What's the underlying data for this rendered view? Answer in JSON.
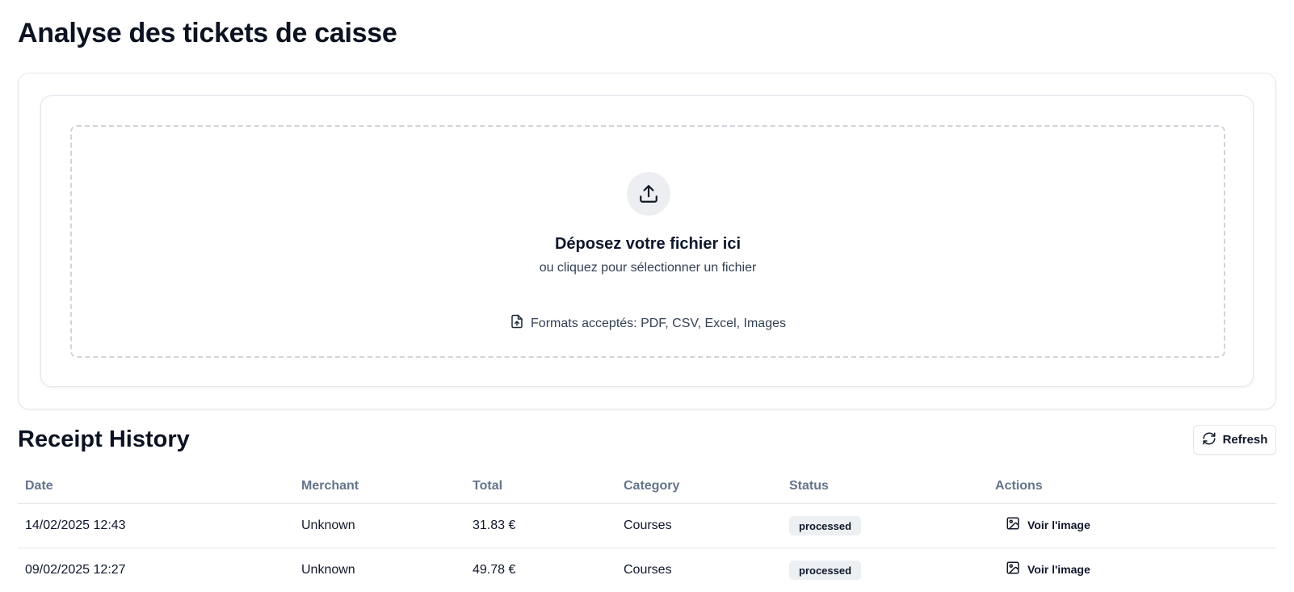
{
  "page": {
    "title": "Analyse des tickets de caisse"
  },
  "upload": {
    "title": "Déposez votre fichier ici",
    "subtitle": "ou cliquez pour sélectionner un fichier",
    "formats": "Formats acceptés: PDF, CSV, Excel, Images",
    "icon": "upload-icon",
    "formats_icon": "file-upload-icon"
  },
  "history": {
    "title": "Receipt History",
    "refresh_label": "Refresh",
    "refresh_icon": "refresh-icon",
    "columns": [
      "Date",
      "Merchant",
      "Total",
      "Category",
      "Status",
      "Actions"
    ],
    "rows": [
      {
        "date": "14/02/2025 12:43",
        "merchant": "Unknown",
        "total": "31.83 €",
        "category": "Courses",
        "status": "processed",
        "action": "Voir l'image"
      },
      {
        "date": "09/02/2025 12:27",
        "merchant": "Unknown",
        "total": "49.78 €",
        "category": "Courses",
        "status": "processed",
        "action": "Voir l'image"
      }
    ],
    "action_icon": "image-icon"
  }
}
